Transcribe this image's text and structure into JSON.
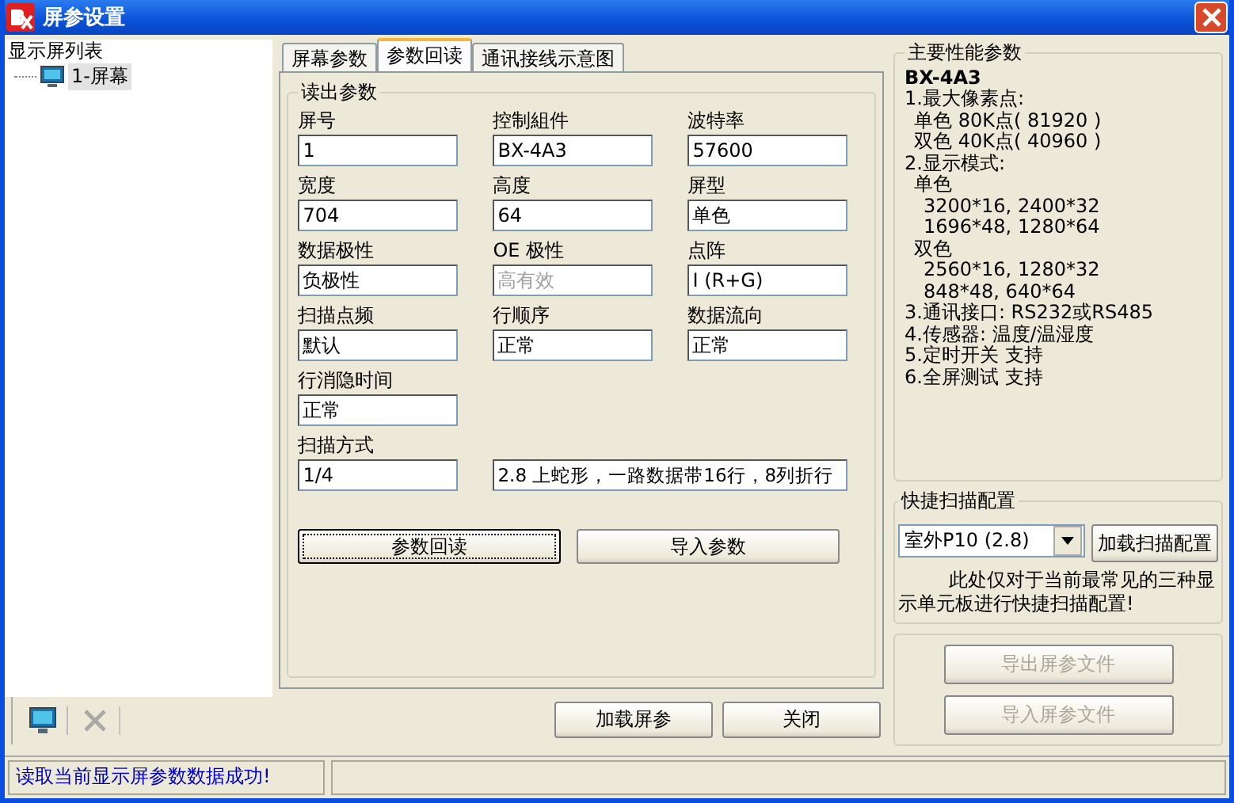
{
  "window": {
    "title": "屏参设置"
  },
  "screen_list": {
    "title": "显示屏列表",
    "items": [
      {
        "label": "1-屏幕",
        "selected": true
      }
    ]
  },
  "toolbar": [
    {
      "kind": "monitor",
      "disabled": false
    },
    {
      "kind": "delete",
      "disabled": true
    }
  ],
  "tabs": [
    {
      "label": "屏幕参数",
      "selected": false
    },
    {
      "label": "参数回读",
      "selected": true
    },
    {
      "label": "通讯接线示意图",
      "selected": false
    }
  ],
  "readout": {
    "title": "读出参数",
    "rows": [
      [
        {
          "kind": "field",
          "label": "屏号",
          "value": "1",
          "disabled": false
        },
        {
          "kind": "field",
          "label": "控制組件",
          "value": "BX-4A3",
          "disabled": false
        },
        {
          "kind": "field",
          "label": "波特率",
          "value": "57600",
          "disabled": false
        }
      ],
      [
        {
          "kind": "field",
          "label": "宽度",
          "value": "704",
          "disabled": false
        },
        {
          "kind": "field",
          "label": "高度",
          "value": "64",
          "disabled": false
        },
        {
          "kind": "field",
          "label": "屏型",
          "value": "单色",
          "disabled": false
        }
      ],
      [
        {
          "kind": "field",
          "label": "数据极性",
          "value": "负极性",
          "disabled": false
        },
        {
          "kind": "field",
          "label": "OE 极性",
          "value": "高有效",
          "disabled": true
        },
        {
          "kind": "field",
          "label": "点阵",
          "value": "I (R+G)",
          "disabled": false
        }
      ],
      [
        {
          "kind": "field",
          "label": "扫描点频",
          "value": "默认",
          "disabled": false
        },
        {
          "kind": "field",
          "label": "行顺序",
          "value": "正常",
          "disabled": false
        },
        {
          "kind": "field",
          "label": "数据流向",
          "value": "正常",
          "disabled": false
        }
      ],
      [
        {
          "kind": "field",
          "label": "行消隐时间",
          "value": "正常",
          "disabled": false
        }
      ],
      [
        {
          "kind": "field",
          "label": "扫描方式",
          "value": "1/4",
          "disabled": false
        },
        {
          "kind": "wide",
          "value": "2.8 上蛇形，一路数据带16行，8列折行",
          "disabled": false
        }
      ]
    ],
    "buttons": [
      {
        "label": "参数回读",
        "focused": true
      },
      {
        "label": "导入参数",
        "focused": false
      }
    ]
  },
  "footer_buttons": [
    "加载屏参",
    "关闭"
  ],
  "specs": {
    "title": "主要性能参数",
    "model": "BX-4A3",
    "items": [
      {
        "text": "1.最大像素点:",
        "children": [
          {
            "text": "单色 80K点( 81920 )"
          },
          {
            "text": "双色 40K点( 40960 )"
          }
        ]
      },
      {
        "text": "2.显示模式:",
        "children": [
          {
            "text": "单色",
            "children": [
              {
                "text": "3200*16, 2400*32"
              },
              {
                "text": "1696*48, 1280*64"
              }
            ]
          },
          {
            "text": "双色",
            "children": [
              {
                "text": "2560*16, 1280*32"
              },
              {
                "text": "848*48, 640*64"
              }
            ]
          }
        ]
      },
      {
        "text": "3.通讯接口: RS232或RS485"
      },
      {
        "text": "4.传感器: 温度/温湿度"
      },
      {
        "text": "5.定时开关 支持"
      },
      {
        "text": "6.全屏测试 支持"
      }
    ]
  },
  "quick_scan": {
    "title": "快捷扫描配置",
    "dropdown": "室外P10 (2.8)",
    "button": "加载扫描配置",
    "note": "此处仅对于当前最常见的三种显示单元板进行快捷扫描配置!"
  },
  "file_buttons": [
    {
      "label": "导出屏参文件",
      "disabled": true
    },
    {
      "label": "导入屏参文件",
      "disabled": true
    }
  ],
  "status_bar": [
    "读取当前显示屏参数数据成功!"
  ]
}
